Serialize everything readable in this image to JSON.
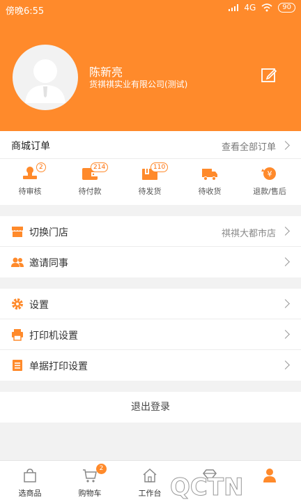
{
  "status_bar": {
    "time": "傍晚6:55",
    "network": "4G",
    "battery": "90"
  },
  "profile": {
    "name": "陈新亮",
    "company": "货祺祺实业有限公司(测试)"
  },
  "orders": {
    "title": "商城订单",
    "view_all": "查看全部订单",
    "items": [
      {
        "label": "待审核",
        "badge": "2"
      },
      {
        "label": "待付款",
        "badge": "214"
      },
      {
        "label": "待发货",
        "badge": "110"
      },
      {
        "label": "待收货"
      },
      {
        "label": "退款/售后"
      }
    ]
  },
  "menu_group1": [
    {
      "label": "切换门店",
      "value": "祺祺大都市店"
    },
    {
      "label": "邀请同事"
    }
  ],
  "menu_group2": [
    {
      "label": "设置"
    },
    {
      "label": "打印机设置"
    },
    {
      "label": "单据打印设置"
    }
  ],
  "logout": "退出登录",
  "tabbar": [
    {
      "label": "选商品"
    },
    {
      "label": "购物车",
      "badge": "2"
    },
    {
      "label": "工作台"
    },
    {
      "label": ""
    },
    {
      "label": ""
    }
  ],
  "watermark_text": "QCTN",
  "colors": {
    "accent": "#ff8a2b",
    "background": "#f2f2f2"
  }
}
